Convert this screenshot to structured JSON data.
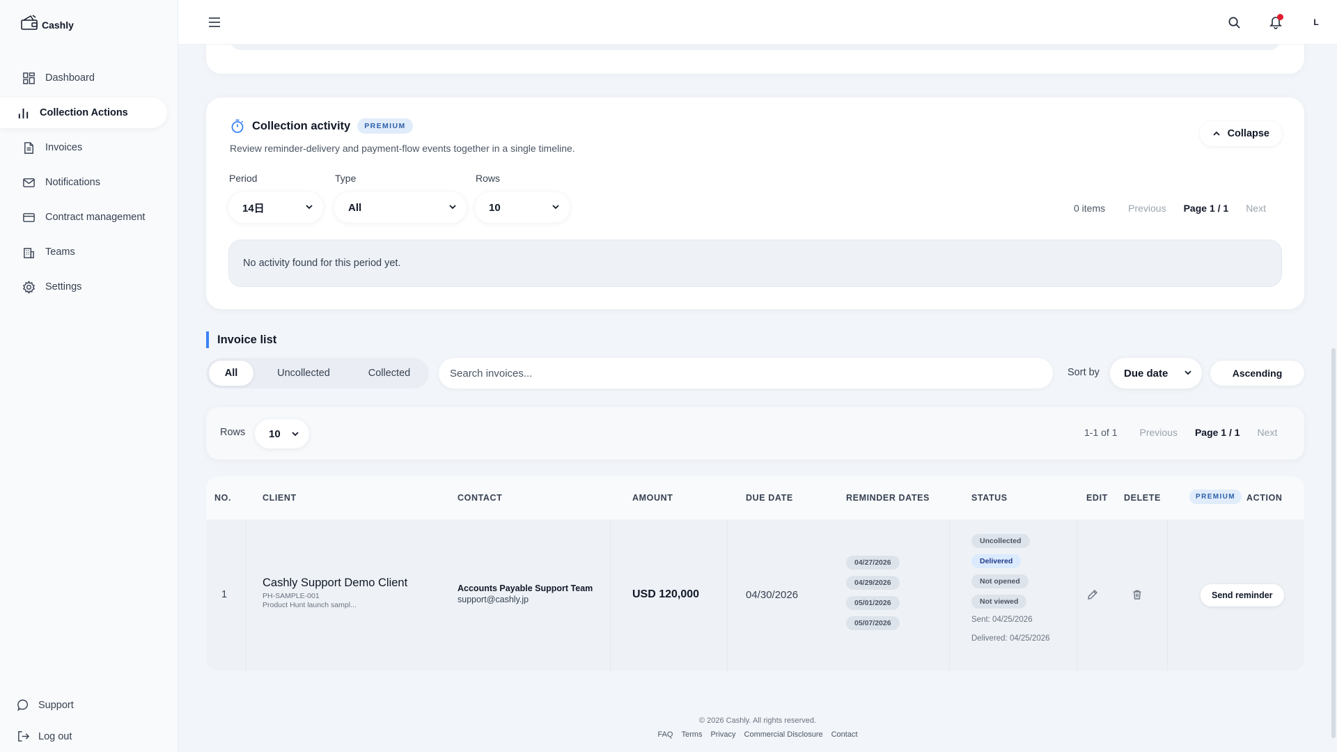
{
  "app": {
    "name": "Cashly"
  },
  "sidebar": {
    "items": [
      {
        "label": "Dashboard",
        "icon": "dashboard-icon",
        "active": false
      },
      {
        "label": "Collection Actions",
        "icon": "bar-chart-icon",
        "active": true
      },
      {
        "label": "Invoices",
        "icon": "document-icon",
        "active": false
      },
      {
        "label": "Notifications",
        "icon": "mail-icon",
        "active": false
      },
      {
        "label": "Contract management",
        "icon": "card-icon",
        "active": false
      },
      {
        "label": "Teams",
        "icon": "building-icon",
        "active": false
      },
      {
        "label": "Settings",
        "icon": "gear-icon",
        "active": false
      }
    ],
    "support_label": "Support",
    "logout_label": "Log out"
  },
  "topbar": {
    "avatar_initial": "L",
    "has_notification": true
  },
  "activity": {
    "title": "Collection activity",
    "badge": "PREMIUM",
    "description": "Review reminder-delivery and payment-flow events together in a single timeline.",
    "collapse_label": "Collapse",
    "period_label": "Period",
    "period_value": "14日",
    "type_label": "Type",
    "type_value": "All",
    "rows_label": "Rows",
    "rows_value": "10",
    "count": "0 items",
    "previous": "Previous",
    "page": "Page 1 / 1",
    "next": "Next",
    "empty": "No activity found for this period yet."
  },
  "invoices": {
    "heading": "Invoice list",
    "tabs": [
      "All",
      "Uncollected",
      "Collected"
    ],
    "active_tab": "All",
    "search_placeholder": "Search invoices...",
    "sort_label": "Sort by",
    "sort_value": "Due date",
    "order_label": "Ascending",
    "rows_label": "Rows",
    "rows_value": "10",
    "range": "1-1 of 1",
    "previous": "Previous",
    "page": "Page 1 / 1",
    "next": "Next",
    "columns": {
      "no": "NO.",
      "client": "CLIENT",
      "contact": "CONTACT",
      "amount": "AMOUNT",
      "due": "DUE DATE",
      "reminders": "REMINDER DATES",
      "status": "STATUS",
      "edit": "EDIT",
      "delete": "DELETE",
      "premium": "PREMIUM",
      "action": "ACTION"
    },
    "rows": [
      {
        "no": "1",
        "client": "Cashly Support Demo Client",
        "client_code": "PH-SAMPLE-001",
        "client_note": "Product Hunt launch sampl...",
        "contact_name": "Accounts Payable Support Team",
        "contact_email": "support@cashly.jp",
        "amount": "USD 120,000",
        "due_date": "04/30/2026",
        "reminders": [
          "04/27/2026",
          "04/29/2026",
          "05/01/2026",
          "05/07/2026"
        ],
        "status_tags": [
          "Uncollected",
          "Delivered",
          "Not opened",
          "Not viewed"
        ],
        "sent": "Sent: 04/25/2026",
        "delivered": "Delivered: 04/25/2026",
        "action_label": "Send reminder"
      }
    ]
  },
  "footer": {
    "copyright": "© 2026 Cashly. All rights reserved.",
    "links": [
      "FAQ",
      "Terms",
      "Privacy",
      "Commercial Disclosure",
      "Contact"
    ]
  },
  "colors": {
    "accent": "#3b82f6",
    "badge_bg": "#e1ecfb",
    "notification": "#e11d2e"
  }
}
